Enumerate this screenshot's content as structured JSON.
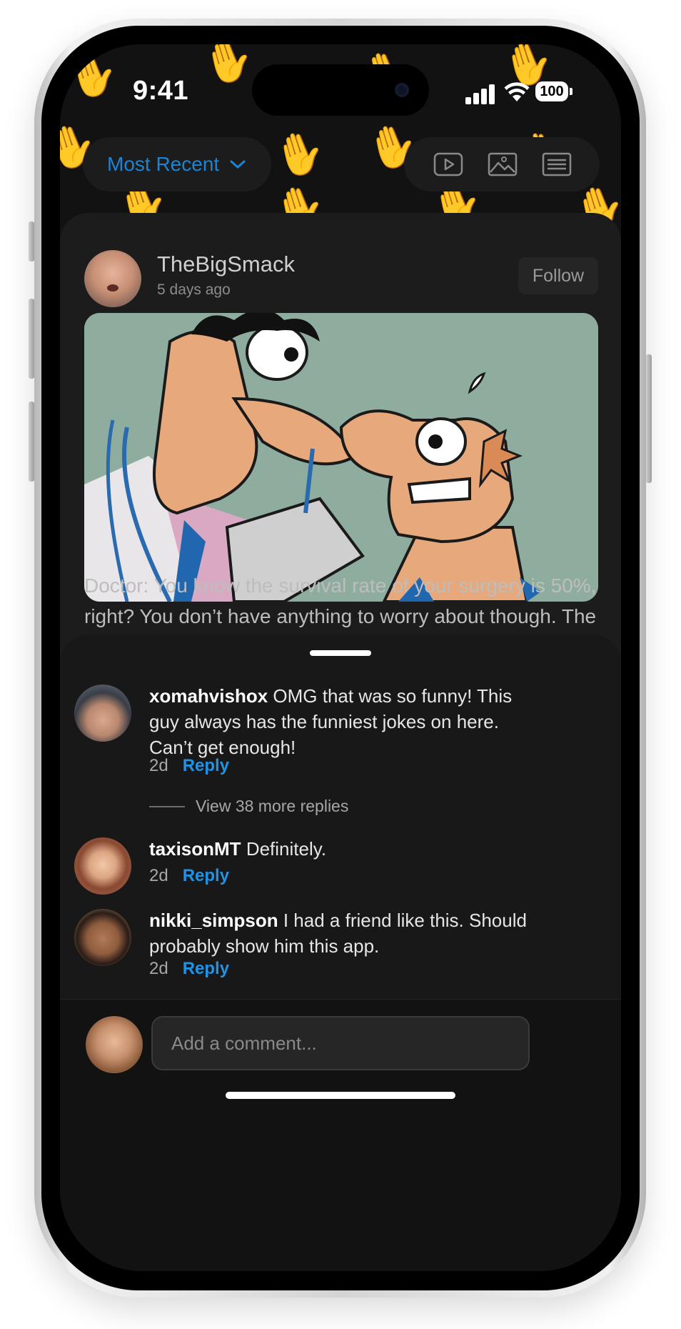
{
  "status_bar": {
    "time": "9:41",
    "battery": "100"
  },
  "filter_bar": {
    "sort_label": "Most Recent",
    "sort_icon": "chevron-down-icon",
    "type_icons": [
      "play-video-icon",
      "image-icon",
      "text-lines-icon"
    ]
  },
  "post": {
    "author": "TheBigSmack",
    "time": "5 days ago",
    "follow_label": "Follow",
    "text": "Doctor: You know the survival rate of your surgery is 50%, right? You don’t have anything to worry about though. The people for any medical"
  },
  "comments": [
    {
      "user": "xomahvishox",
      "text": "OMG that was so funny! This guy always has the funniest jokes on here. Can’t get enough!",
      "age": "2d",
      "reply_label": "Reply"
    },
    {
      "user": "taxisonMT",
      "text": "Definitely.",
      "age": "2d",
      "reply_label": "Reply"
    },
    {
      "user": "nikki_simpson",
      "text": "I had a friend like this. Should probably show him this app.",
      "age": "2d",
      "reply_label": "Reply"
    }
  ],
  "view_more_replies": "View 38 more replies",
  "composer": {
    "placeholder": "Add a comment..."
  },
  "colors": {
    "accent": "#1f93e8",
    "sort_accent": "#1a84d6",
    "background": "#121212",
    "sheet": "#181818"
  }
}
